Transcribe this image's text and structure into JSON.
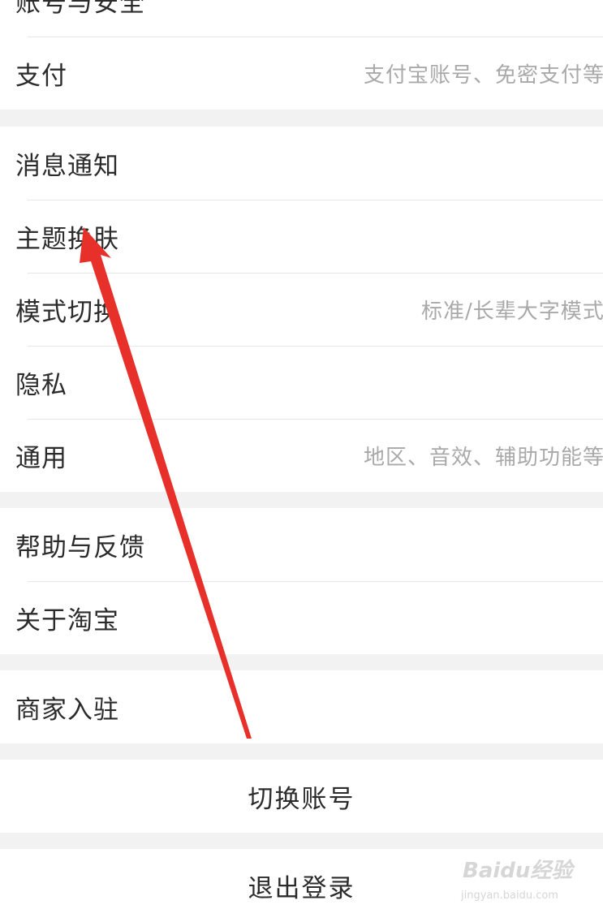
{
  "settings": {
    "group1": {
      "account_security": "账号与安全",
      "payment": {
        "label": "支付",
        "hint": "支付宝账号、免密支付等"
      }
    },
    "group2": {
      "notifications": "消息通知",
      "theme": "主题换肤",
      "mode": {
        "label": "模式切换",
        "hint": "标准/长辈大字模式"
      },
      "privacy": "隐私",
      "general": {
        "label": "通用",
        "hint": "地区、音效、辅助功能等"
      }
    },
    "group3": {
      "help": "帮助与反馈",
      "about": "关于淘宝"
    },
    "group4": {
      "merchant": "商家入驻"
    },
    "switch_account": "切换账号",
    "logout": "退出登录"
  },
  "annotation": {
    "arrow_color": "#e8302a"
  },
  "watermark": {
    "logo": "Baidu经验",
    "url": "jingyan.baidu.com"
  }
}
